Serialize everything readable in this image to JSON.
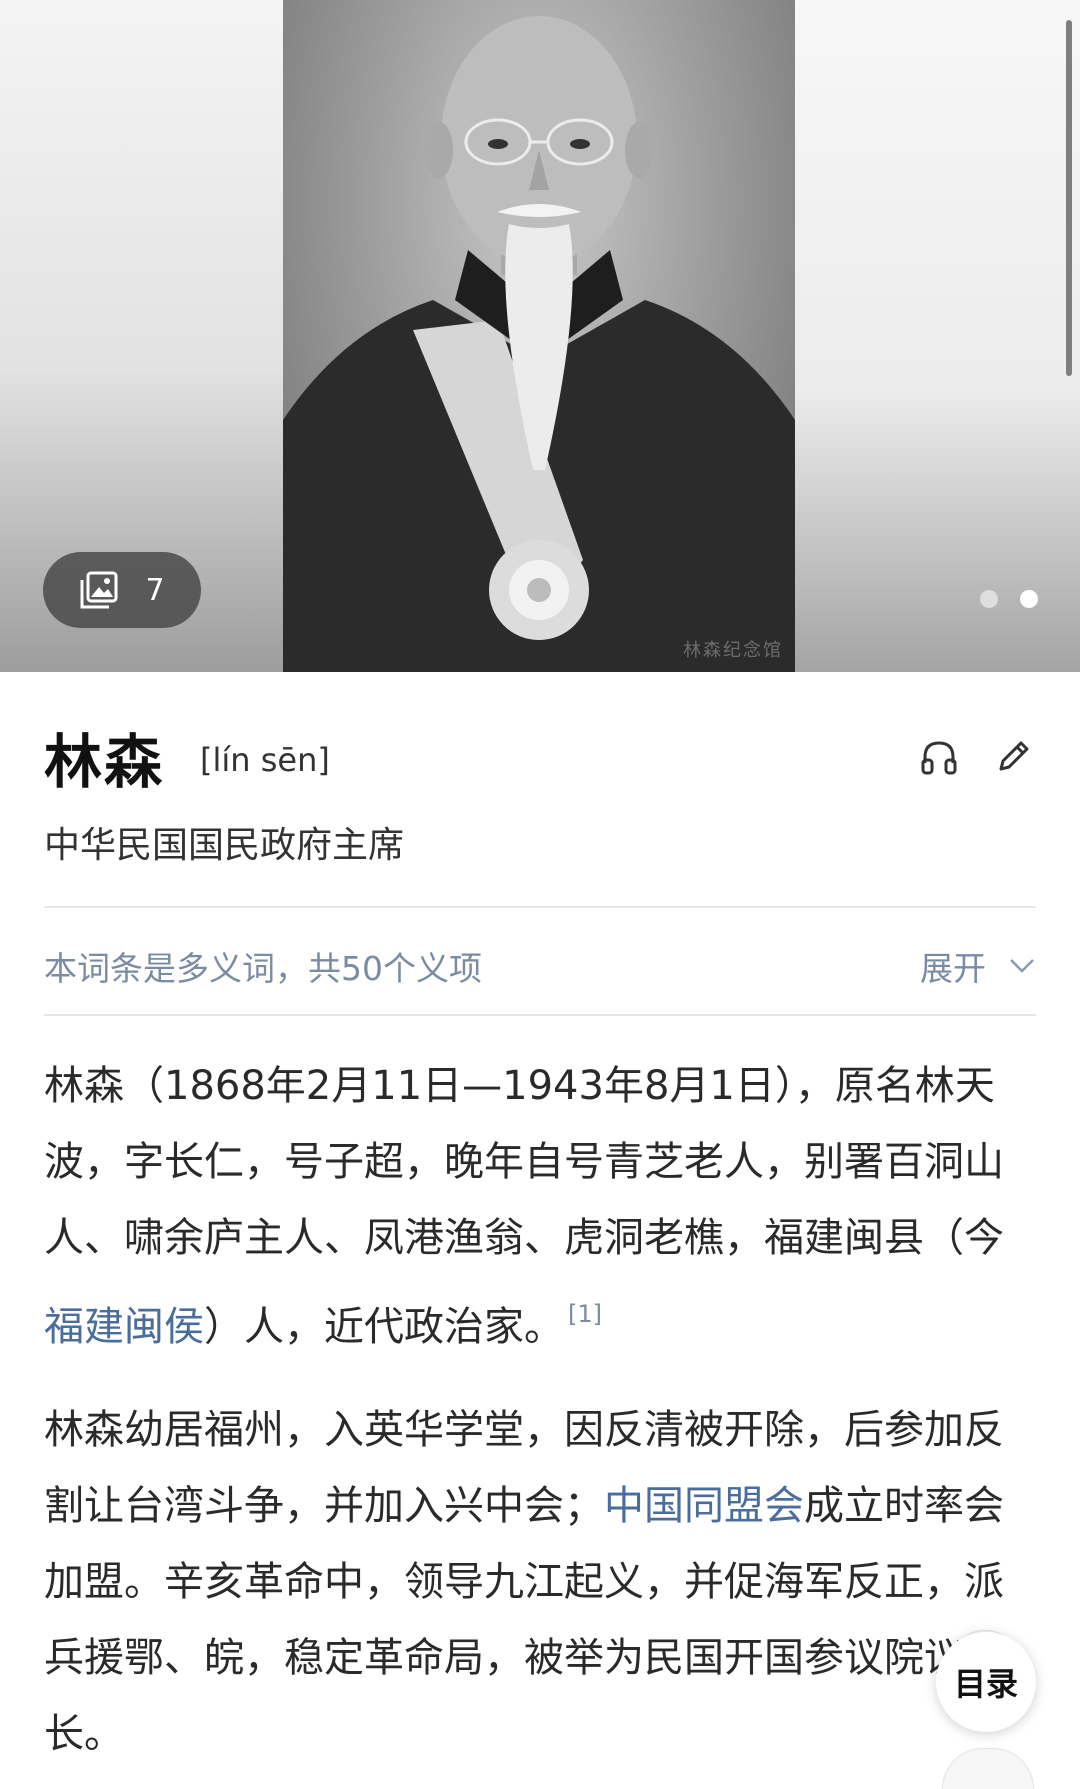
{
  "hero": {
    "photo_count": "7",
    "gallery_icon": "image-gallery-icon",
    "watermark": "林森纪念馆"
  },
  "entry": {
    "title": "林森",
    "pinyin": "[lín sēn]",
    "subtitle": "中华民国国民政府主席",
    "audio_icon": "headphones-icon",
    "edit_icon": "pencil-icon"
  },
  "polysemy": {
    "text": "本词条是多义词，共50个义项",
    "expand_label": "展开",
    "expand_icon": "chevron-down-icon"
  },
  "paragraphs": {
    "p1": {
      "before": "林森（1868年2月11日—1943年8月1日），原名林天波，字长仁，号子超，晚年自号青芝老人，别署百洞山人、啸余庐主人、凤港渔翁、虎洞老樵，福建闽县（今",
      "link": "福建闽侯",
      "after": "）人，近代政治家。",
      "ref": "[1]"
    },
    "p2": {
      "before": "林森幼居福州，入英华学堂，因反清被开除，后参加反割让台湾斗争，并加入兴中会；",
      "link": "中国同盟会",
      "after": "成立时率会加盟。辛亥革命中，领导九江起义，并促海军反正，派兵援鄂、皖，稳定革命局，被举为民国开国参议院议长。"
    }
  },
  "toc": {
    "label": "目录"
  },
  "colors": {
    "link": "#4a6d9c",
    "muted": "#7a8ca3",
    "text": "#2a2a2a"
  }
}
